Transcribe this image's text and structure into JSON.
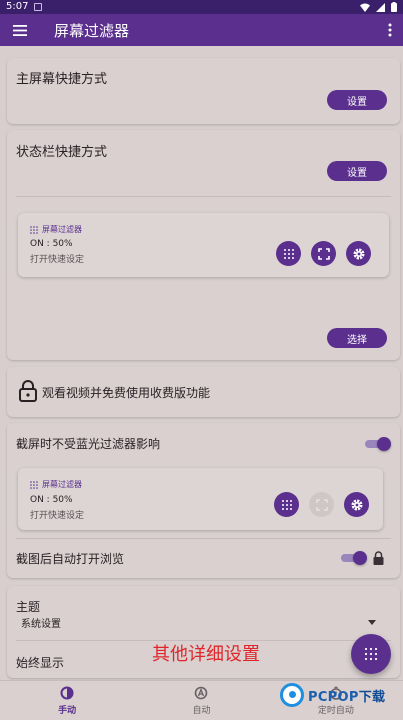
{
  "statusbar": {
    "time": "5:07"
  },
  "appbar": {
    "title": "屏幕过滤器"
  },
  "home_shortcut": {
    "title": "主屏幕快捷方式",
    "button": "设置"
  },
  "statusbar_shortcut": {
    "title": "状态栏快捷方式",
    "button": "设置",
    "tile": {
      "label": "屏幕过滤器",
      "state": "ON : 50%",
      "hint": "打开快速设定"
    },
    "select_button": "选择"
  },
  "unlock": {
    "text": "观看视频并免费使用收费版功能"
  },
  "screenshot": {
    "title": "截屏时不受蓝光过滤器影响",
    "toggle_on": true,
    "tile": {
      "label": "屏幕过滤器",
      "state": "ON : 50%",
      "hint": "打开快速设定"
    },
    "auto_open": {
      "label": "截图后自动打开浏览",
      "toggle_on": true
    }
  },
  "theme": {
    "title": "主题",
    "value": "系统设置"
  },
  "always_show": {
    "label": "始终显示",
    "toggle_on": false
  },
  "overlay": {
    "text": "其他详细设置"
  },
  "bottomnav": {
    "items": [
      {
        "label": "手动"
      },
      {
        "label": "自动"
      },
      {
        "label": "定时自动"
      }
    ]
  },
  "watermark": {
    "brand": "PCPOP",
    "suffix": "下载"
  },
  "colors": {
    "primary": "#5a2f8e",
    "statusbar": "#3a1f6a",
    "background": "#d7cecd",
    "overlay_text": "#e0262b"
  }
}
